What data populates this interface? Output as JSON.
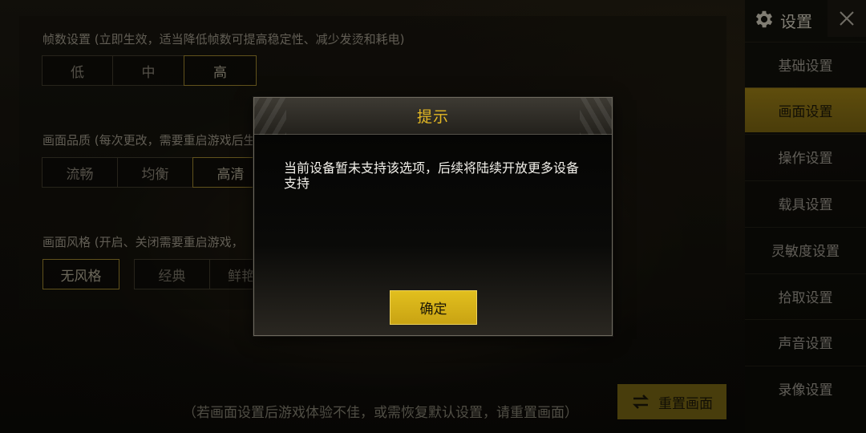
{
  "header": {
    "title": "设置"
  },
  "sections": {
    "framerate": {
      "title": "帧数设置 (立即生效，适当降低帧数可提高稳定性、减少发烫和耗电)",
      "options": [
        "低",
        "中",
        "高"
      ],
      "selected": "高"
    },
    "quality": {
      "title": "画面品质 (每次更改，需要重启游戏后生效)",
      "options": [
        "流畅",
        "均衡",
        "高清"
      ],
      "selected": "高清"
    },
    "style": {
      "title": "画面风格 (开启、关闭需要重启游戏，",
      "options": [
        "无风格",
        "经典",
        "鲜艳"
      ],
      "selected": "无风格"
    }
  },
  "sidebar": {
    "items": [
      {
        "label": "基础设置"
      },
      {
        "label": "画面设置",
        "active": true
      },
      {
        "label": "操作设置"
      },
      {
        "label": "载具设置"
      },
      {
        "label": "灵敏度设置"
      },
      {
        "label": "拾取设置"
      },
      {
        "label": "声音设置"
      },
      {
        "label": "录像设置"
      }
    ]
  },
  "footer": {
    "hint": "（若画面设置后游戏体验不佳，或需恢复默认设置，请重置画面）",
    "reset_label": "重置画面"
  },
  "dialog": {
    "title": "提示",
    "message": "当前设备暂未支持该选项，后续将陆续开放更多设备支持",
    "confirm_label": "确定"
  },
  "colors": {
    "accent_gold": "#e1bf1e",
    "title_gold": "#e3b824",
    "active_tab": "#8c7214"
  },
  "icons": {
    "settings": "gear-icon",
    "close": "close-icon",
    "reset": "reset-icon"
  }
}
